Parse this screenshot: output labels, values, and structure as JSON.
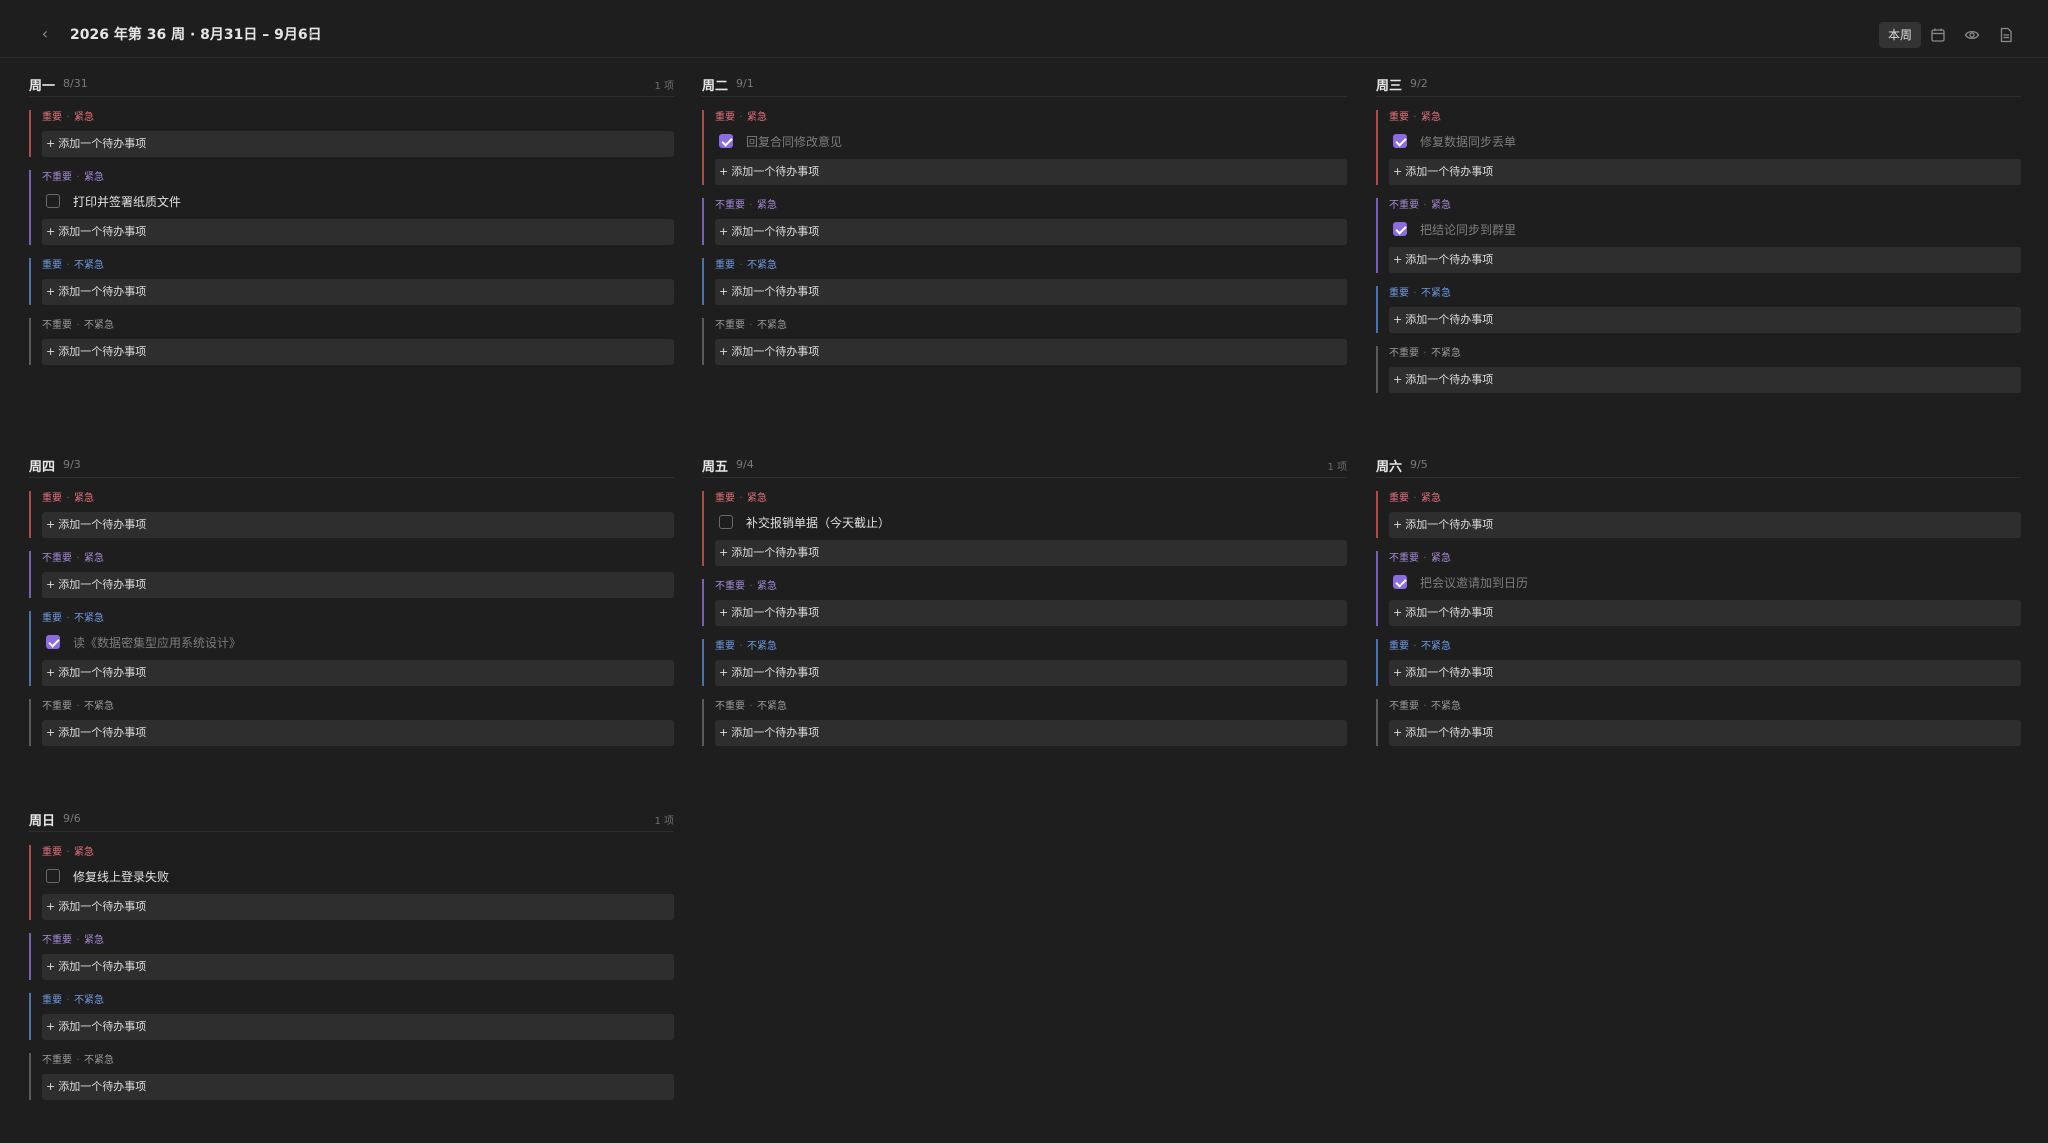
{
  "header": {
    "week_title": "2026 年第 36 周 · 8月31日 – 9月6日",
    "this_week_label": "本周",
    "prev_icon": "chevron-left-icon",
    "next_icon": "chevron-right-icon",
    "tools": [
      "calendar-icon",
      "eye-icon",
      "document-icon"
    ]
  },
  "colors": {
    "background": "#1e1e1e",
    "important_urgent": "#e2707a",
    "unimportant_urgent": "#a48ad6",
    "important_not_urgent": "#6f9ae0",
    "neither": "#9a9a9a",
    "checkbox_checked": "#8b6ce0"
  },
  "add_label": "添加一个待办事项",
  "tag_sep": "·",
  "days": [
    {
      "name": "周一",
      "date": "8/31",
      "count": "1 项",
      "quadrants": [
        {
          "t1": "重要",
          "t2": "紧急",
          "todos": []
        },
        {
          "t1": "不重要",
          "t2": "紧急",
          "todos": [
            {
              "text": "打印并签署纸质文件",
              "done": false
            }
          ]
        },
        {
          "t1": "重要",
          "t2": "不紧急",
          "todos": []
        },
        {
          "t1": "不重要",
          "t2": "不紧急",
          "todos": []
        }
      ]
    },
    {
      "name": "周二",
      "date": "9/1",
      "count": "",
      "quadrants": [
        {
          "t1": "重要",
          "t2": "紧急",
          "todos": [
            {
              "text": "回复合同修改意见",
              "done": true
            }
          ]
        },
        {
          "t1": "不重要",
          "t2": "紧急",
          "todos": []
        },
        {
          "t1": "重要",
          "t2": "不紧急",
          "todos": []
        },
        {
          "t1": "不重要",
          "t2": "不紧急",
          "todos": []
        }
      ]
    },
    {
      "name": "周三",
      "date": "9/2",
      "count": "",
      "quadrants": [
        {
          "t1": "重要",
          "t2": "紧急",
          "todos": [
            {
              "text": "修复数据同步丢单",
              "done": true
            }
          ]
        },
        {
          "t1": "不重要",
          "t2": "紧急",
          "todos": [
            {
              "text": "把结论同步到群里",
              "done": true
            }
          ]
        },
        {
          "t1": "重要",
          "t2": "不紧急",
          "todos": []
        },
        {
          "t1": "不重要",
          "t2": "不紧急",
          "todos": []
        }
      ]
    },
    {
      "name": "周四",
      "date": "9/3",
      "count": "",
      "quadrants": [
        {
          "t1": "重要",
          "t2": "紧急",
          "todos": []
        },
        {
          "t1": "不重要",
          "t2": "紧急",
          "todos": []
        },
        {
          "t1": "重要",
          "t2": "不紧急",
          "todos": [
            {
              "text": "读《数据密集型应用系统设计》",
              "done": true
            }
          ]
        },
        {
          "t1": "不重要",
          "t2": "不紧急",
          "todos": []
        }
      ]
    },
    {
      "name": "周五",
      "date": "9/4",
      "count": "1 项",
      "quadrants": [
        {
          "t1": "重要",
          "t2": "紧急",
          "todos": [
            {
              "text": "补交报销单据（今天截止）",
              "done": false
            }
          ]
        },
        {
          "t1": "不重要",
          "t2": "紧急",
          "todos": []
        },
        {
          "t1": "重要",
          "t2": "不紧急",
          "todos": []
        },
        {
          "t1": "不重要",
          "t2": "不紧急",
          "todos": []
        }
      ]
    },
    {
      "name": "周六",
      "date": "9/5",
      "count": "",
      "quadrants": [
        {
          "t1": "重要",
          "t2": "紧急",
          "todos": []
        },
        {
          "t1": "不重要",
          "t2": "紧急",
          "todos": [
            {
              "text": "把会议邀请加到日历",
              "done": true
            }
          ]
        },
        {
          "t1": "重要",
          "t2": "不紧急",
          "todos": []
        },
        {
          "t1": "不重要",
          "t2": "不紧急",
          "todos": []
        }
      ]
    },
    {
      "name": "周日",
      "date": "9/6",
      "count": "1 项",
      "quadrants": [
        {
          "t1": "重要",
          "t2": "紧急",
          "todos": [
            {
              "text": "修复线上登录失败",
              "done": false
            }
          ]
        },
        {
          "t1": "不重要",
          "t2": "紧急",
          "todos": []
        },
        {
          "t1": "重要",
          "t2": "不紧急",
          "todos": []
        },
        {
          "t1": "不重要",
          "t2": "不紧急",
          "todos": []
        }
      ]
    }
  ]
}
